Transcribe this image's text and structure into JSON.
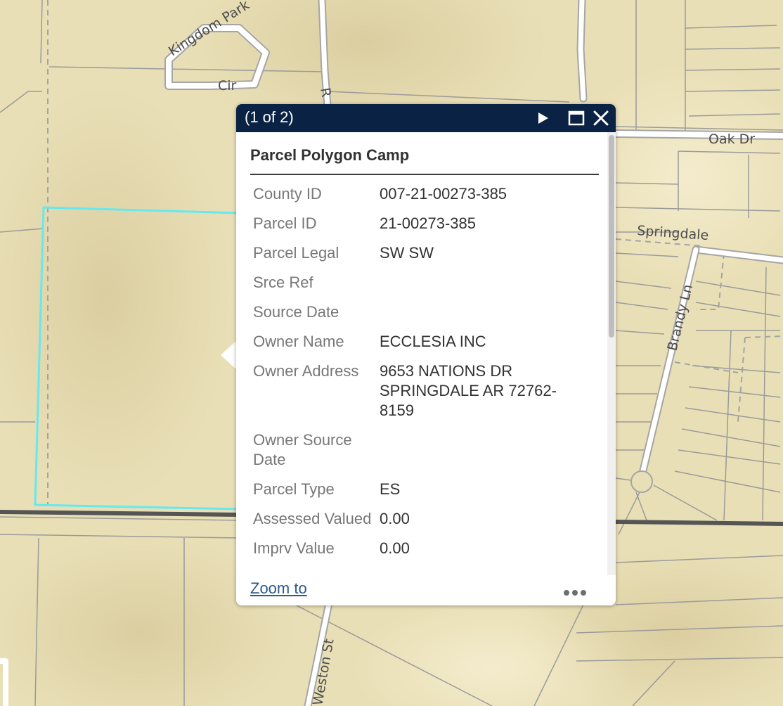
{
  "map": {
    "street_labels": [
      "Kingdom Park",
      "Cir",
      "Oak Dr",
      "Springdale",
      "Brandy Ln",
      "Weston St",
      "R"
    ],
    "colors": {
      "background": "#e9dfb6",
      "lines": "#9a9a9a",
      "selected_parcel": "#66e8ee",
      "major_road": "#555555"
    }
  },
  "popup": {
    "count": "(1 of 2)",
    "title": "Parcel Polygon Camp",
    "header_color": "#0a2344",
    "icons": {
      "next": "play-next-icon",
      "maximize": "maximize-icon",
      "close": "close-icon",
      "more": "more-options-icon"
    },
    "fields": [
      {
        "label": "County ID",
        "value": "007-21-00273-385"
      },
      {
        "label": "Parcel ID",
        "value": "21-00273-385"
      },
      {
        "label": "Parcel Legal",
        "value": "SW SW"
      },
      {
        "label": "Srce Ref",
        "value": ""
      },
      {
        "label": "Source Date",
        "value": ""
      },
      {
        "label": "Owner Name",
        "value": "ECCLESIA INC"
      },
      {
        "label": "Owner Address",
        "value": "9653 NATIONS DR SPRINGDALE AR 72762-8159"
      },
      {
        "label": "Owner Source Date",
        "value": ""
      },
      {
        "label": "Parcel Type",
        "value": "ES"
      },
      {
        "label": "Assessed Valued",
        "value": "0.00"
      },
      {
        "label": "Imprv Value",
        "value": "0.00"
      }
    ],
    "zoom_to": "Zoom to"
  }
}
